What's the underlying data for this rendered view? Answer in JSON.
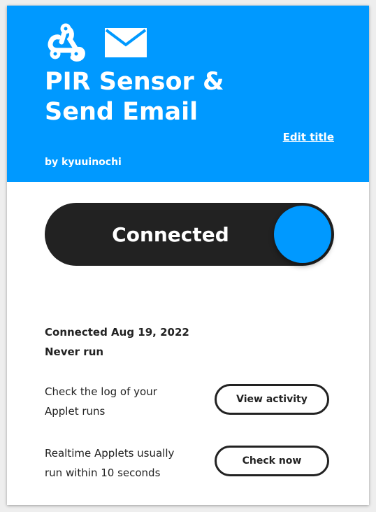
{
  "applet": {
    "title": "PIR Sensor & Send Email",
    "edit_title_label": "Edit title",
    "author": "by kyuuinochi",
    "service_icons": [
      "webhook-icon",
      "email-icon"
    ]
  },
  "toggle": {
    "label": "Connected",
    "state": "on"
  },
  "status": {
    "connected": "Connected Aug 19, 2022",
    "last_run": "Never run"
  },
  "rows": [
    {
      "text_line1": "Check the log of your",
      "text_line2": "Applet runs",
      "button": "View activity"
    },
    {
      "text_line1": "Realtime Applets usually",
      "text_line2": "run within 10 seconds",
      "button": "Check now"
    }
  ],
  "colors": {
    "brand": "#0099ff",
    "dark": "#222222",
    "background": "#ffffff"
  }
}
